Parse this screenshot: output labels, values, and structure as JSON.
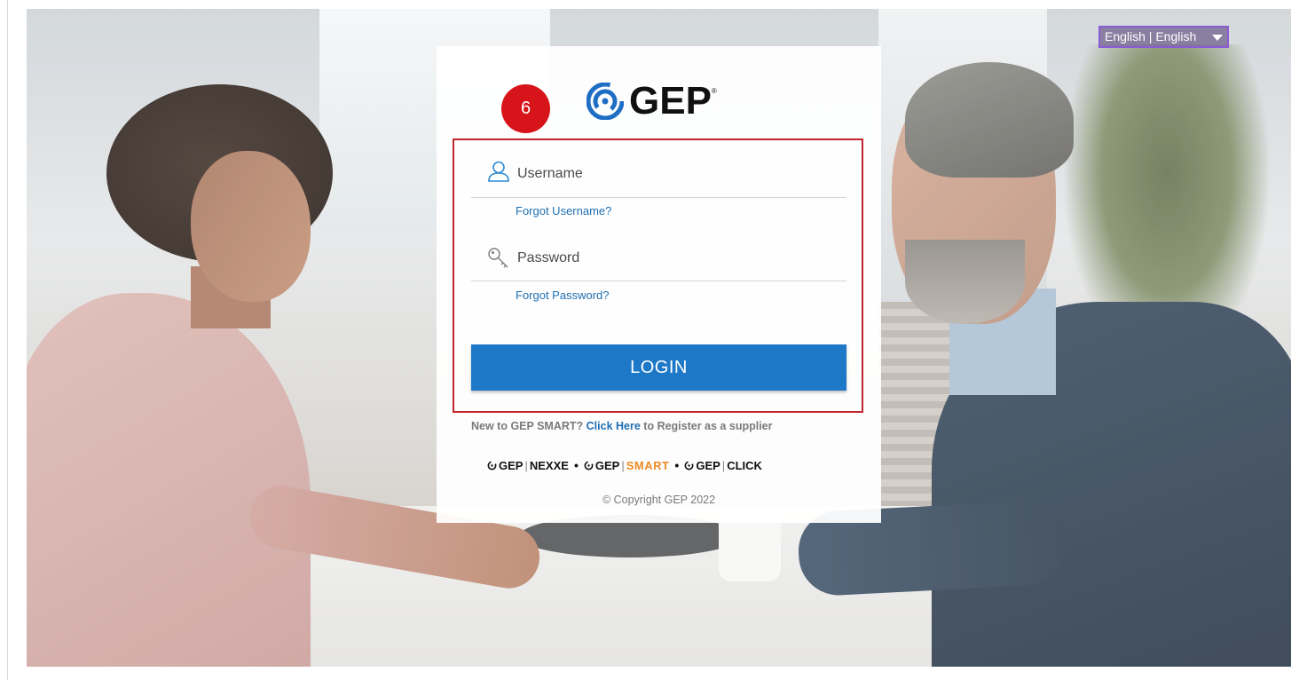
{
  "language_selector": {
    "label": "English | English",
    "icon": "chevron-down-icon"
  },
  "step_badge": {
    "number": "6",
    "color": "#d7141a"
  },
  "brand": {
    "logo_text": "GEP",
    "registered_mark": "®"
  },
  "login_form": {
    "username_placeholder": "Username",
    "username_icon": "user-icon",
    "forgot_username": "Forgot Username?",
    "password_placeholder": "Password",
    "password_icon": "key-icon",
    "forgot_password": "Forgot Password?",
    "login_button": "LOGIN",
    "highlight_color": "#c0262d",
    "button_color": "#1e78c8"
  },
  "register": {
    "prefix": "New to GEP SMART?",
    "link_text": "Click Here",
    "suffix": "to Register as a supplier"
  },
  "products": [
    {
      "brand": "GEP",
      "name": "NEXXE"
    },
    {
      "brand": "GEP",
      "name": "SMART"
    },
    {
      "brand": "GEP",
      "name": "CLICK"
    }
  ],
  "footer": {
    "copyright": "© Copyright GEP 2022"
  }
}
